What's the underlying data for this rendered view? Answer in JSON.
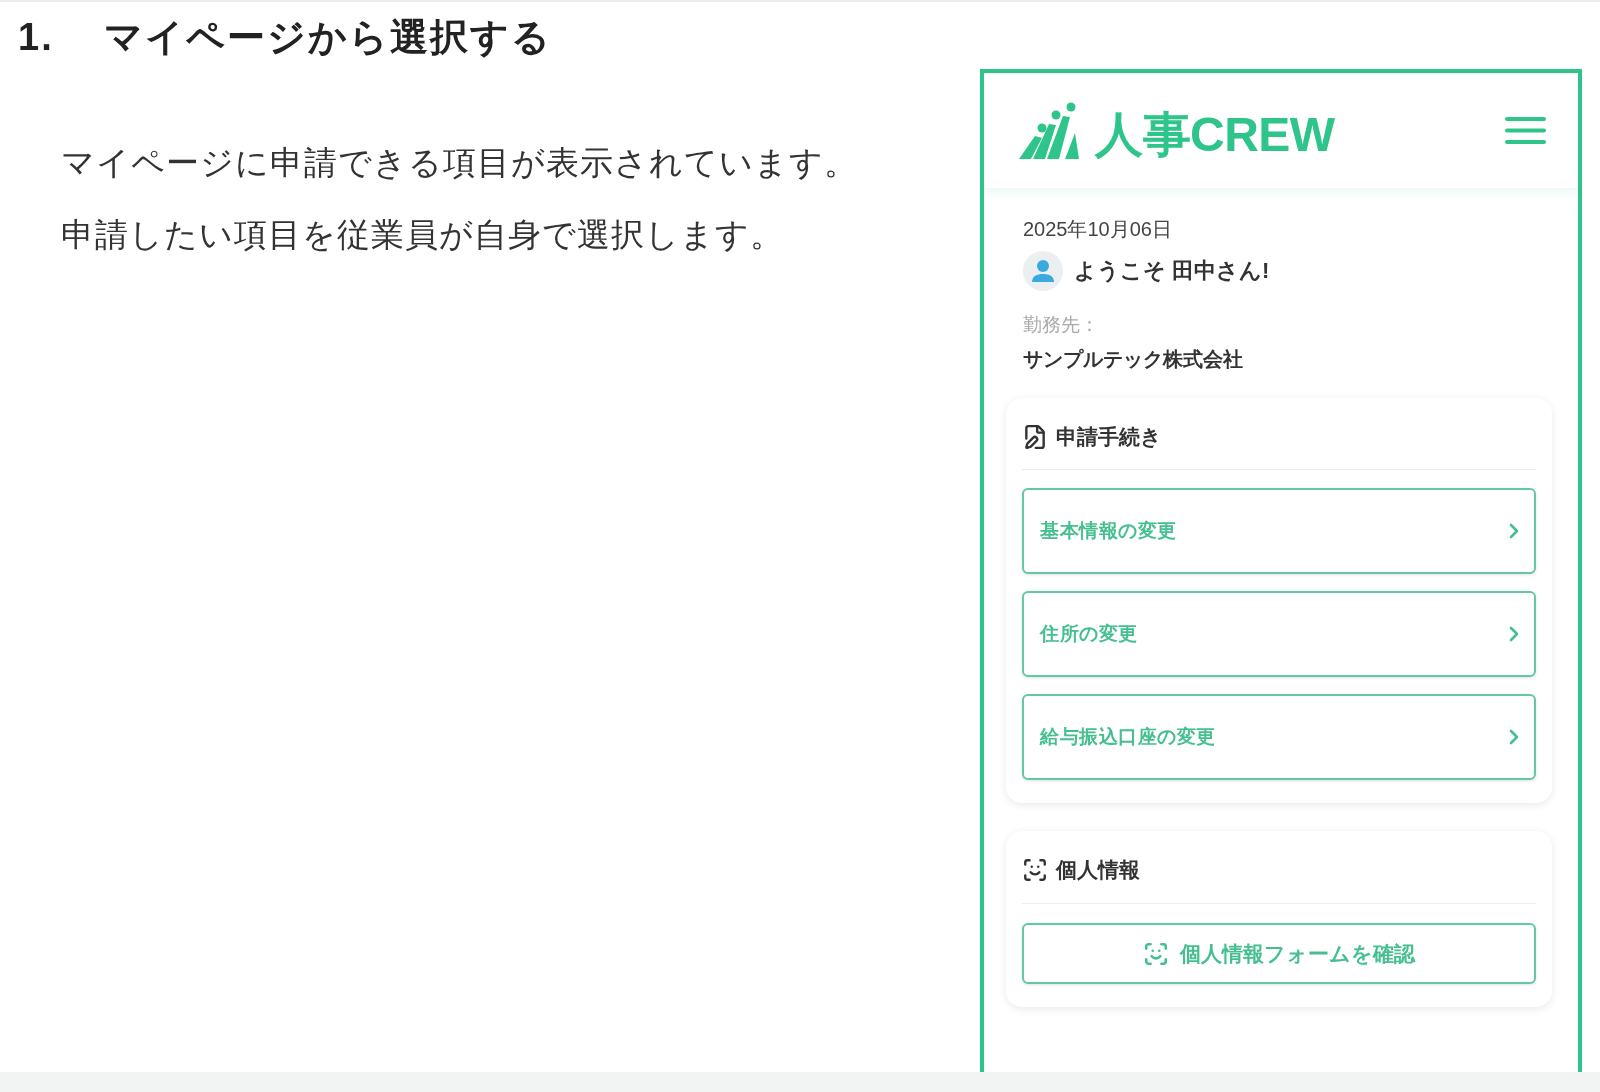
{
  "heading": {
    "number": "1.",
    "title": "マイページから選択する"
  },
  "paragraphs": [
    "マイページに申請できる項目が表示されています。",
    "申請したい項目を従業員が自身で選択します。"
  ],
  "phone": {
    "logo": {
      "text": "人事CREW"
    },
    "date": "2025年10月06日",
    "greeting": "ようこそ 田中さん!",
    "workplace_label": "勤務先：",
    "workplace": "サンプルテック株式会社",
    "sections": [
      {
        "kind": "links",
        "title": "申請手続き",
        "items": [
          "基本情報の変更",
          "住所の変更",
          "給与振込口座の変更"
        ]
      },
      {
        "kind": "action",
        "title": "個人情報",
        "button": "個人情報フォームを確認"
      }
    ]
  }
}
